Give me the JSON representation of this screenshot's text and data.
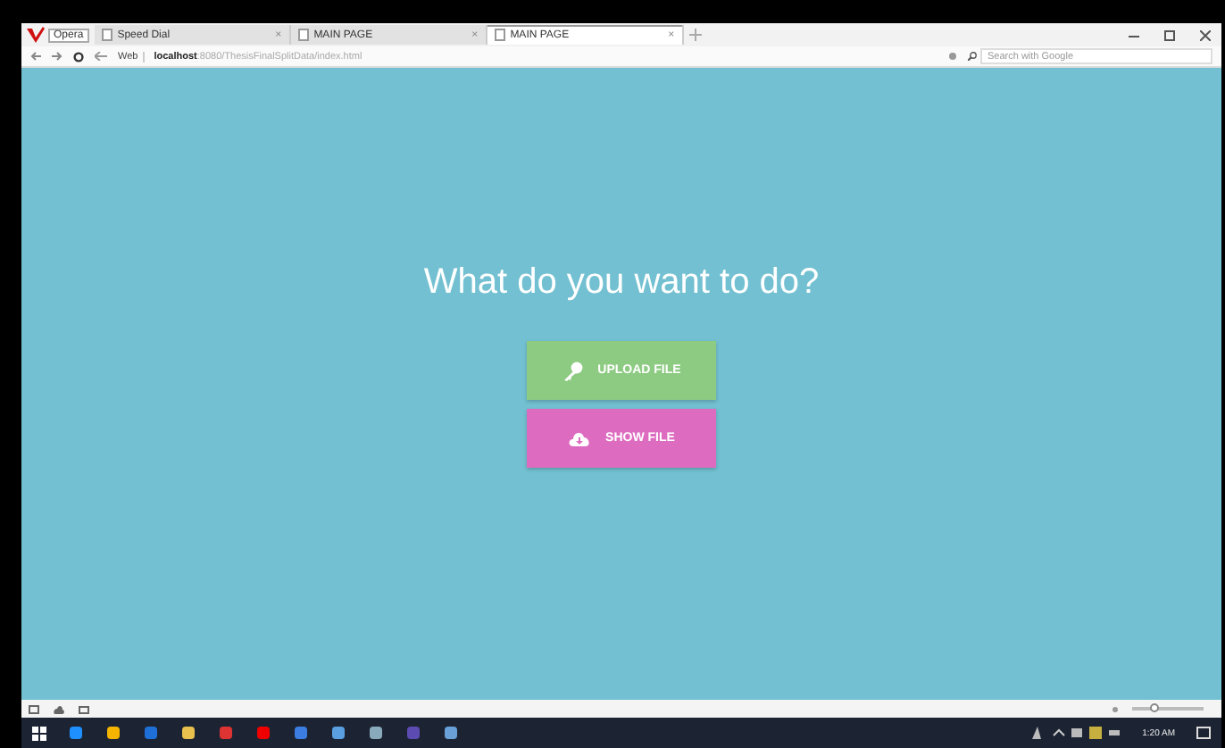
{
  "browser": {
    "menu_label": "Opera",
    "tabs": [
      {
        "label": "Speed Dial",
        "close": "×",
        "selected": false
      },
      {
        "label": "MAIN PAGE",
        "close": "×",
        "selected": false
      },
      {
        "label": "MAIN PAGE",
        "close": "×",
        "selected": true
      }
    ],
    "address": {
      "scheme": "Web",
      "host": "localhost",
      "path": ":8080/ThesisFinalSplitData/index.html"
    },
    "search": {
      "placeholder": "Search with Google"
    }
  },
  "page": {
    "heading": "What do you want to do?",
    "buttons": [
      {
        "kind": "upload",
        "label": "UPLOAD FILE"
      },
      {
        "kind": "show",
        "label": "SHOW FILE"
      }
    ]
  },
  "status_bar": {
    "zoom": {
      "level": 0.3
    }
  },
  "taskbar": {
    "time": "1:20 AM"
  }
}
